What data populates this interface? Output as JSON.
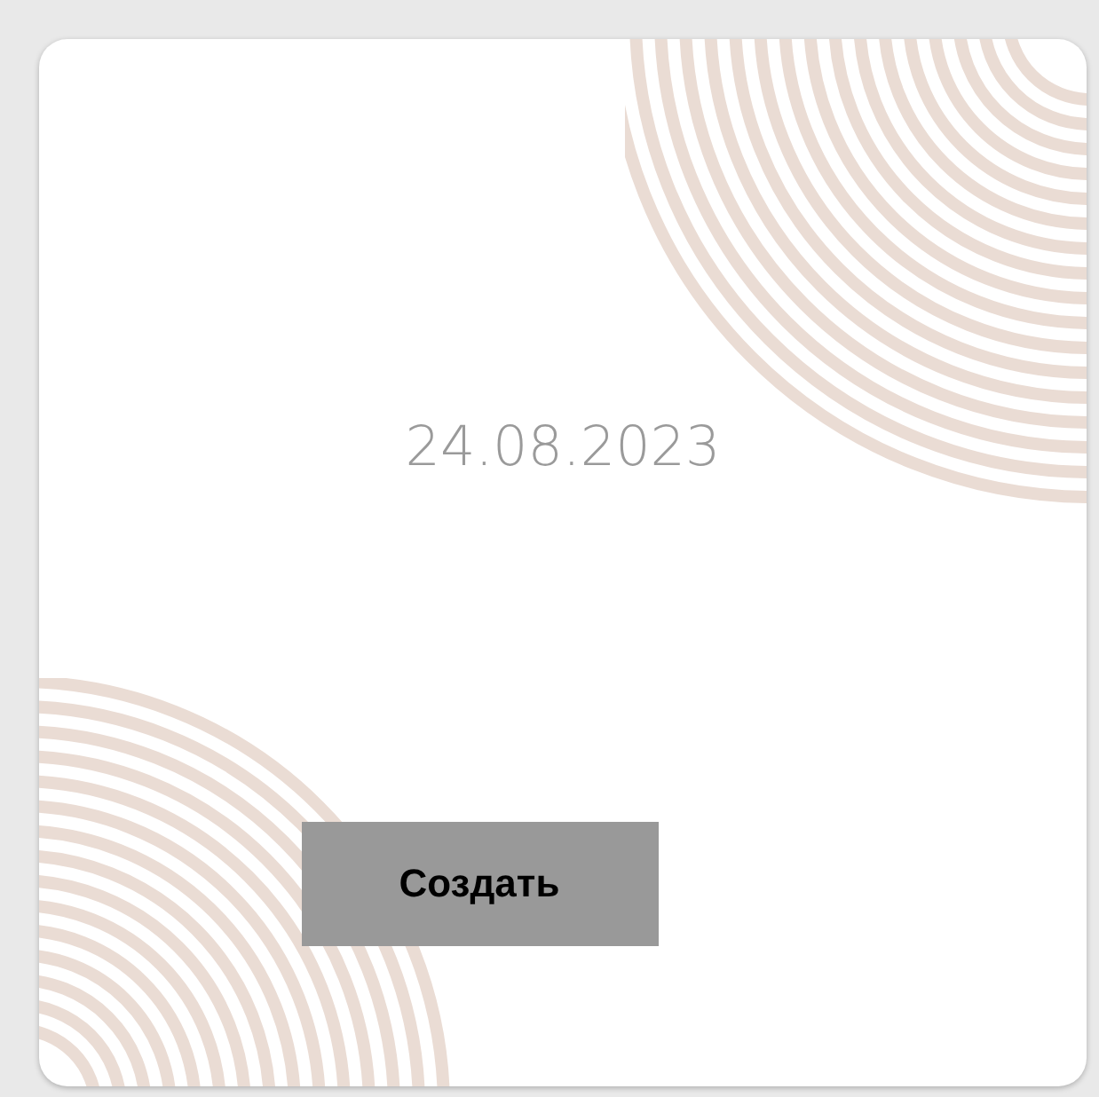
{
  "card": {
    "date": "24.08.2023",
    "button": "Создать"
  }
}
